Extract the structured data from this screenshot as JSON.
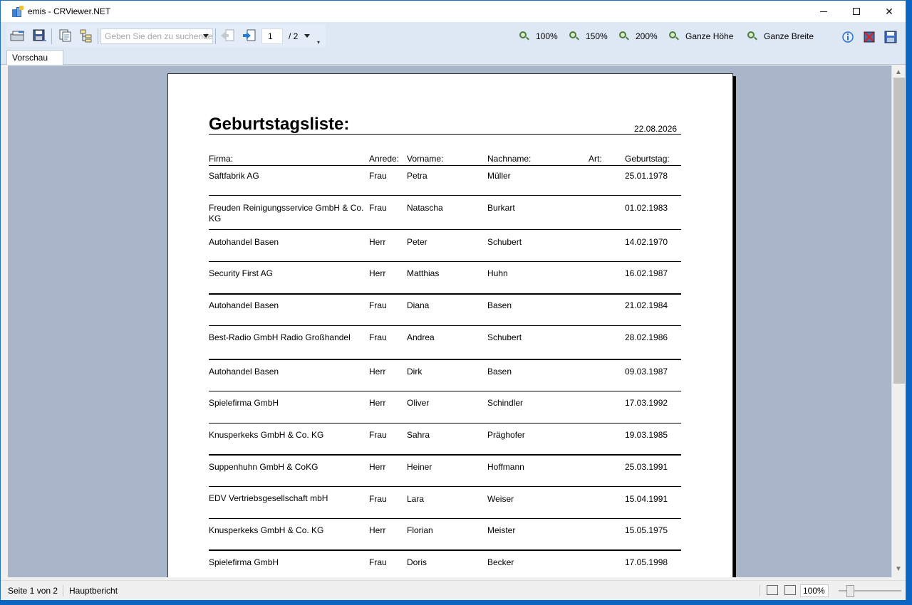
{
  "window": {
    "title": "emis - CRViewer.NET"
  },
  "toolbar": {
    "search_placeholder": "Geben Sie den zu suchenden Text ein",
    "page_current": "1",
    "page_total": "/ 2",
    "zoom_buttons": [
      "100%",
      "150%",
      "200%",
      "Ganze Höhe",
      "Ganze Breite"
    ]
  },
  "tabs": {
    "preview": "Vorschau"
  },
  "report": {
    "title": "Geburtstagsliste:",
    "date": "22.08.2026",
    "headers": {
      "firma": "Firma:",
      "anrede": "Anrede:",
      "vorname": "Vorname:",
      "nachname": "Nachname:",
      "art": "Art:",
      "geburtstag": "Geburtstag:"
    },
    "rows": [
      {
        "firma": "Saftfabrik AG",
        "anrede": "Frau",
        "vorname": "Petra",
        "nachname": "Müller",
        "geburtstag": "25.01.1978"
      },
      {
        "firma": "Freuden Reinigungsservice GmbH & Co. KG",
        "anrede": "Frau",
        "vorname": "Natascha",
        "nachname": "Burkart",
        "geburtstag": "01.02.1983"
      },
      {
        "firma": "Autohandel Basen",
        "anrede": "Herr",
        "vorname": "Peter",
        "nachname": "Schubert",
        "geburtstag": "14.02.1970"
      },
      {
        "firma": "Security First AG",
        "anrede": "Herr",
        "vorname": "Matthias",
        "nachname": "Huhn",
        "geburtstag": "16.02.1987"
      },
      {
        "firma": "Autohandel Basen",
        "anrede": "Frau",
        "vorname": "Diana",
        "nachname": "Basen",
        "geburtstag": "21.02.1984"
      },
      {
        "firma": "Best-Radio GmbH Radio Großhandel",
        "anrede": "Frau",
        "vorname": "Andrea",
        "nachname": "Schubert",
        "geburtstag": "28.02.1986"
      },
      {
        "firma": "Autohandel Basen",
        "anrede": "Herr",
        "vorname": "Dirk",
        "nachname": "Basen",
        "geburtstag": "09.03.1987"
      },
      {
        "firma": "Spielefirma GmbH",
        "anrede": "Herr",
        "vorname": "Oliver",
        "nachname": "Schindler",
        "geburtstag": "17.03.1992"
      },
      {
        "firma": "Knusperkeks GmbH & Co. KG",
        "anrede": "Frau",
        "vorname": "Sahra",
        "nachname": "Präghofer",
        "geburtstag": "19.03.1985"
      },
      {
        "firma": "Suppenhuhn GmbH & CoKG",
        "anrede": "Herr",
        "vorname": "Heiner",
        "nachname": "Hoffmann",
        "geburtstag": "25.03.1991"
      },
      {
        "firma": "EDV Vertriebsgesellschaft mbH",
        "anrede": "Frau",
        "vorname": "Lara",
        "nachname": "Weiser",
        "geburtstag": "15.04.1991"
      },
      {
        "firma": "Knusperkeks GmbH & Co. KG",
        "anrede": "Herr",
        "vorname": "Florian",
        "nachname": "Meister",
        "geburtstag": "15.05.1975"
      },
      {
        "firma": "Spielefirma GmbH",
        "anrede": "Frau",
        "vorname": "Doris",
        "nachname": "Becker",
        "geburtstag": "17.05.1998"
      }
    ]
  },
  "status": {
    "page": "Seite 1 von 2",
    "report": "Hauptbericht",
    "zoom": "100%"
  }
}
